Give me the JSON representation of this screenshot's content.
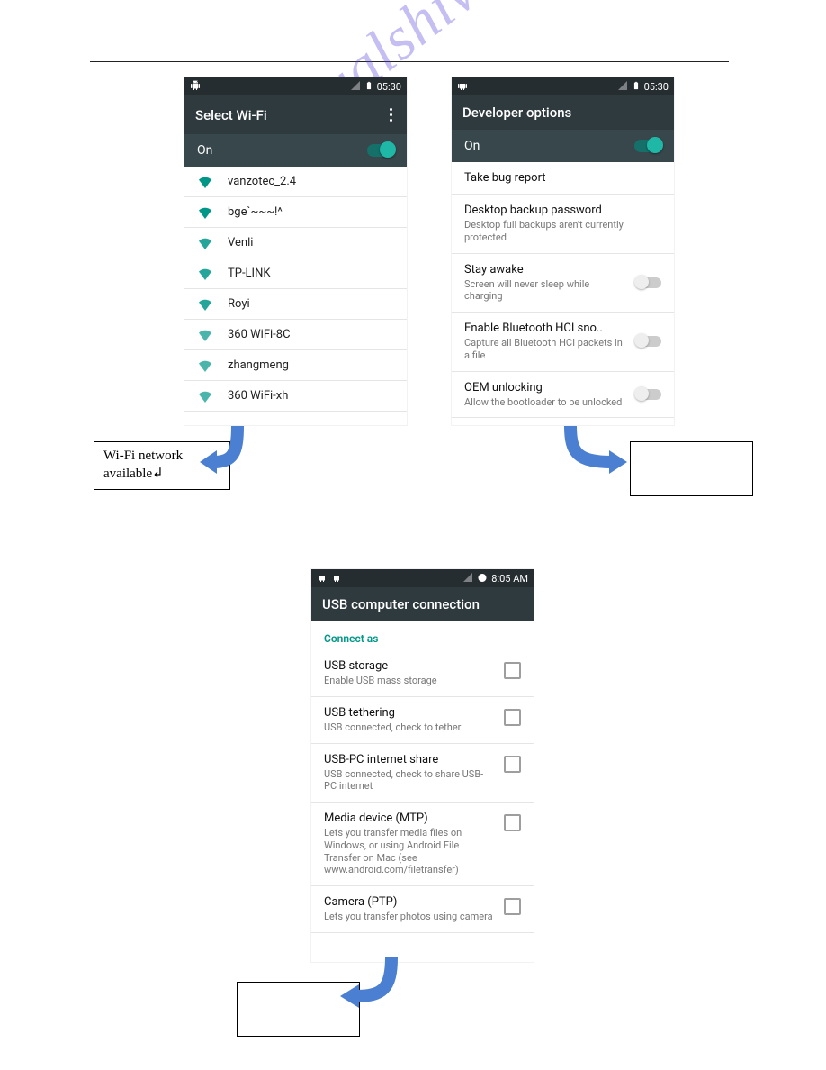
{
  "watermark_text": "manualshive.com",
  "callouts": {
    "wifi_box": "Wi-Fi   network\navailable↲",
    "dev_box": "",
    "usb_box": ""
  },
  "wifi_screen": {
    "time": "05:30",
    "title": "Select Wi-Fi",
    "toggle_label": "On",
    "networks": [
      {
        "name": "vanzotec_2.4",
        "strength": "full"
      },
      {
        "name": "bge`~~~!^",
        "strength": "full"
      },
      {
        "name": "Venli",
        "strength": "mid"
      },
      {
        "name": "TP-LINK",
        "strength": "mid"
      },
      {
        "name": "Royi",
        "strength": "mid"
      },
      {
        "name": "360     WiFi-8C",
        "strength": "low"
      },
      {
        "name": "zhangmeng",
        "strength": "low"
      },
      {
        "name": "360     WiFi-xh",
        "strength": "low"
      }
    ]
  },
  "dev_screen": {
    "time": "05:30",
    "title": "Developer options",
    "toggle_label": "On",
    "items": [
      {
        "title": "Take bug report",
        "sub": "",
        "switch": null
      },
      {
        "title": "Desktop backup password",
        "sub": "Desktop full backups aren't currently protected",
        "switch": null
      },
      {
        "title": "Stay awake",
        "sub": "Screen will never sleep while charging",
        "switch": false
      },
      {
        "title": "Enable Bluetooth HCI sno..",
        "sub": "Capture all Bluetooth HCI packets in a file",
        "switch": false
      },
      {
        "title": "OEM unlocking",
        "sub": "Allow the bootloader to be unlocked",
        "switch": false
      }
    ]
  },
  "usb_screen": {
    "time": "8:05 AM",
    "title": "USB computer connection",
    "section": "Connect as",
    "items": [
      {
        "title": "USB storage",
        "sub": "Enable USB mass storage"
      },
      {
        "title": "USB tethering",
        "sub": "USB connected, check to tether"
      },
      {
        "title": "USB-PC internet share",
        "sub": "USB connected, check to share USB-PC internet"
      },
      {
        "title": "Media device (MTP)",
        "sub": "Lets you transfer media files on Windows, or using Android File Transfer on Mac (see www.android.com/filetransfer)"
      },
      {
        "title": "Camera (PTP)",
        "sub": "Lets you transfer photos using camera"
      }
    ]
  }
}
